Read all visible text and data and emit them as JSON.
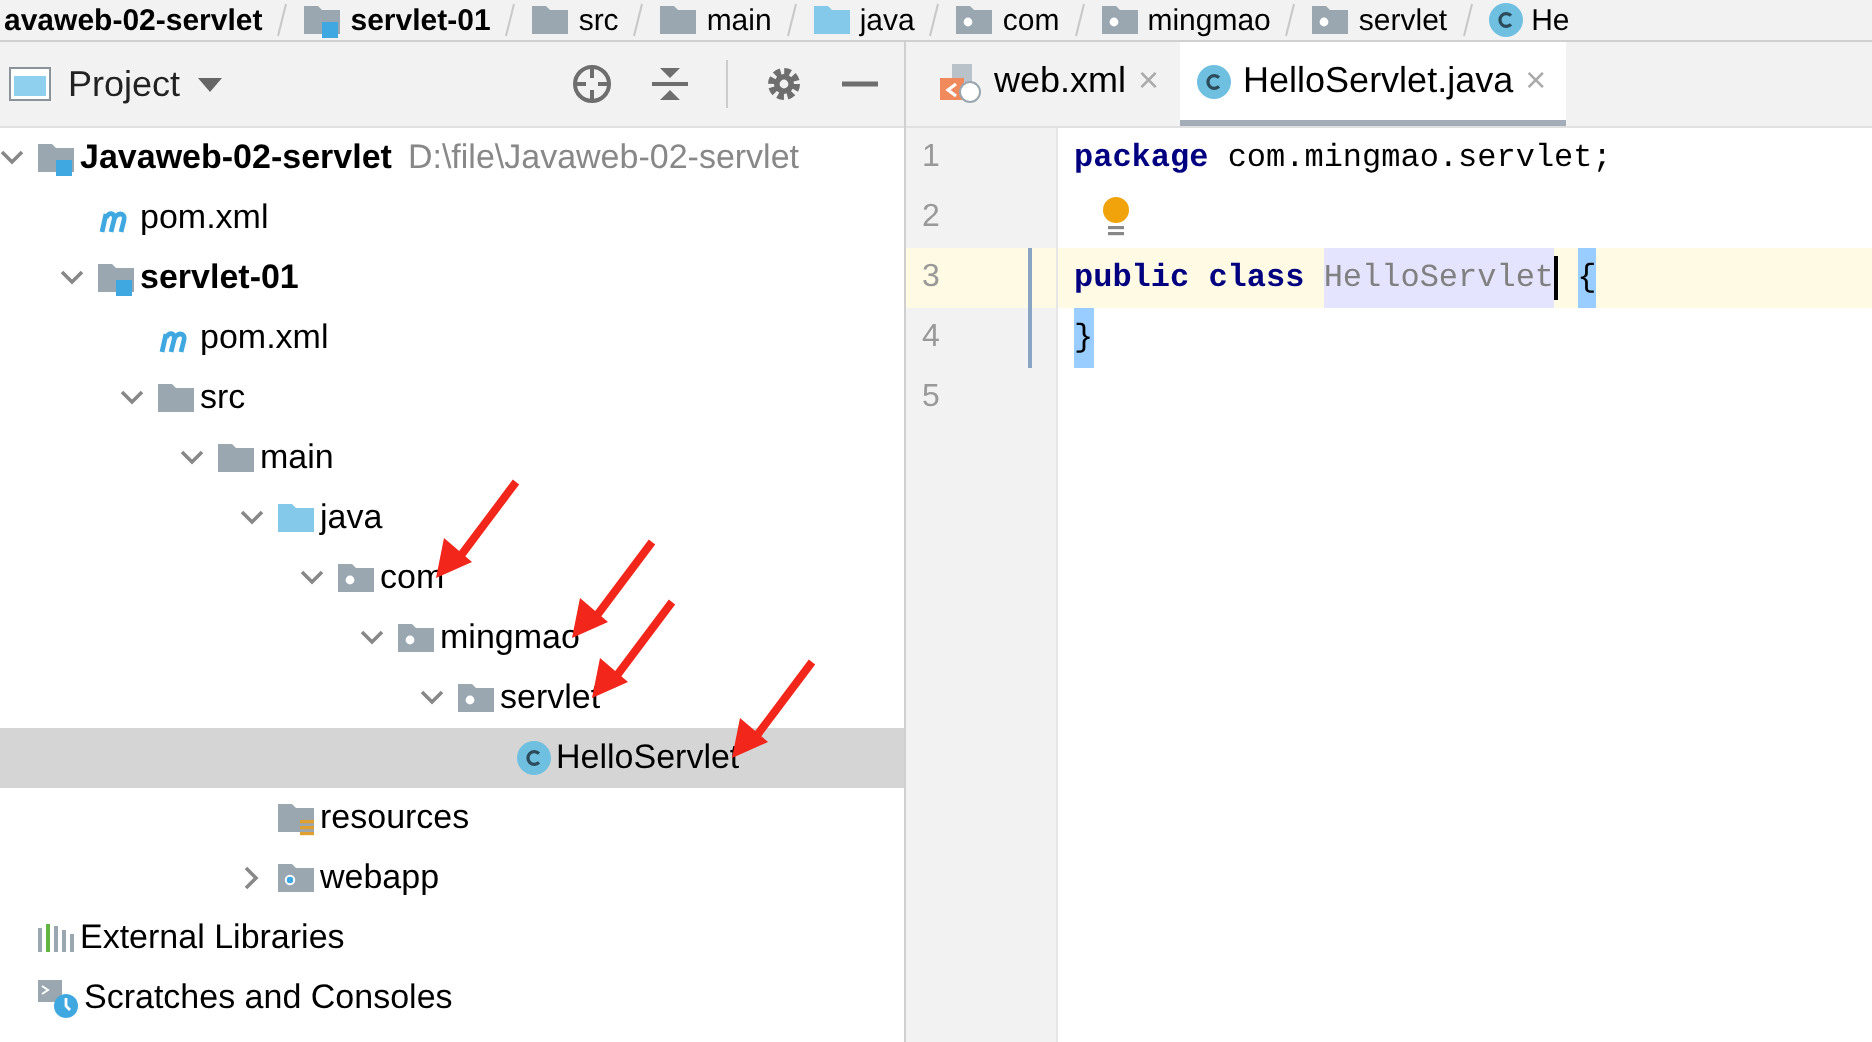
{
  "breadcrumbs": [
    {
      "label": "avaweb-02-servlet",
      "kind": "module"
    },
    {
      "label": "servlet-01",
      "kind": "module"
    },
    {
      "label": "src",
      "kind": "folder"
    },
    {
      "label": "main",
      "kind": "folder"
    },
    {
      "label": "java",
      "kind": "source"
    },
    {
      "label": "com",
      "kind": "package"
    },
    {
      "label": "mingmao",
      "kind": "package"
    },
    {
      "label": "servlet",
      "kind": "package"
    },
    {
      "label": "He",
      "kind": "class"
    }
  ],
  "project_panel": {
    "title": "Project",
    "tree": [
      {
        "label": "Javaweb-02-servlet",
        "kind": "module",
        "path": "D:\\file\\Javaweb-02-servlet",
        "expanded": true,
        "selected": false,
        "marked": false,
        "children": [
          {
            "label": "pom.xml",
            "kind": "maven",
            "selected": false,
            "marked": false
          },
          {
            "label": "servlet-01",
            "kind": "module",
            "expanded": true,
            "selected": false,
            "marked": false,
            "children": [
              {
                "label": "pom.xml",
                "kind": "maven",
                "selected": false,
                "marked": false
              },
              {
                "label": "src",
                "kind": "folder",
                "expanded": true,
                "selected": false,
                "marked": false,
                "children": [
                  {
                    "label": "main",
                    "kind": "folder",
                    "expanded": true,
                    "selected": false,
                    "marked": false,
                    "children": [
                      {
                        "label": "java",
                        "kind": "source",
                        "expanded": true,
                        "selected": false,
                        "marked": false,
                        "children": [
                          {
                            "label": "com",
                            "kind": "package",
                            "expanded": true,
                            "selected": false,
                            "marked": true,
                            "children": [
                              {
                                "label": "mingmao",
                                "kind": "package",
                                "expanded": true,
                                "selected": false,
                                "marked": true,
                                "children": [
                                  {
                                    "label": "servlet",
                                    "kind": "package",
                                    "expanded": true,
                                    "selected": false,
                                    "marked": true,
                                    "children": [
                                      {
                                        "label": "HelloServlet",
                                        "kind": "class",
                                        "selected": true,
                                        "marked": true
                                      }
                                    ]
                                  }
                                ]
                              }
                            ]
                          }
                        ]
                      },
                      {
                        "label": "resources",
                        "kind": "resources",
                        "selected": false,
                        "marked": false
                      },
                      {
                        "label": "webapp",
                        "kind": "web",
                        "expanded": false,
                        "selected": false,
                        "marked": false
                      }
                    ]
                  }
                ]
              }
            ]
          }
        ]
      },
      {
        "label": "External Libraries",
        "kind": "libraries",
        "selected": false,
        "marked": false
      },
      {
        "label": "Scratches and Consoles",
        "kind": "scratches",
        "selected": false,
        "marked": false
      }
    ]
  },
  "editor": {
    "tabs": [
      {
        "label": "web.xml",
        "kind": "xml",
        "close": "×",
        "selected": false
      },
      {
        "label": "HelloServlet.java",
        "kind": "class",
        "close": "×",
        "selected": true
      }
    ],
    "lines": [
      {
        "number": "1",
        "current": false,
        "bulb": false,
        "tokens": [
          {
            "kind": "keyword",
            "text": "package"
          },
          {
            "kind": "plain",
            "text": "com.mingmao.servlet;"
          }
        ]
      },
      {
        "number": "2",
        "current": false,
        "bulb": true
      },
      {
        "number": "3",
        "current": true,
        "bulb": false,
        "tokens": [
          {
            "kind": "keyword",
            "text": "public"
          },
          {
            "kind": "keyword",
            "text": "class"
          },
          {
            "kind": "unused",
            "text": "HelloServlet"
          },
          {
            "kind": "caret"
          },
          {
            "kind": "brace",
            "text": "{"
          }
        ]
      },
      {
        "number": "4",
        "current": false,
        "bulb": false,
        "tokens": [
          {
            "kind": "brace",
            "text": "}"
          }
        ]
      },
      {
        "number": "5",
        "current": false,
        "bulb": false
      }
    ]
  }
}
